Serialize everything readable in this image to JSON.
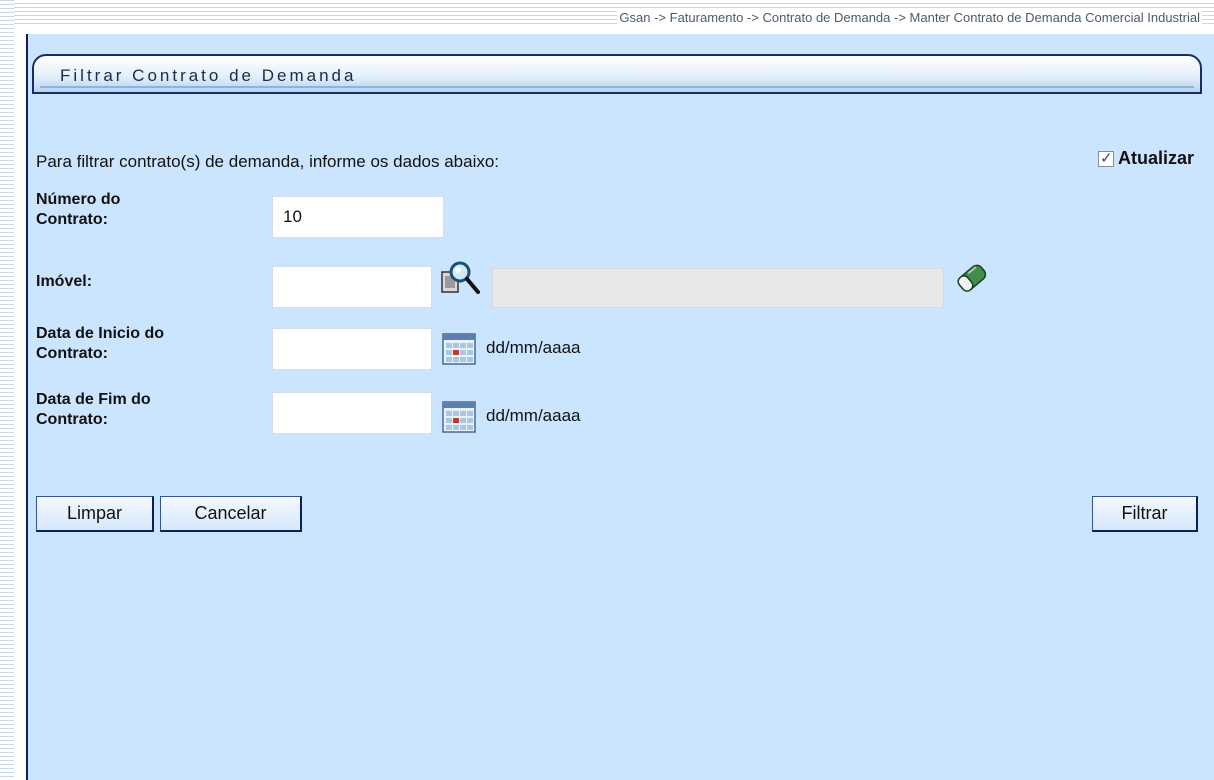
{
  "breadcrumb": "Gsan -> Faturamento -> Contrato de Demanda -> Manter Contrato de Demanda Comercial Industrial",
  "panel": {
    "title": "Filtrar Contrato de Demanda",
    "instructions": "Para filtrar contrato(s) de demanda, informe os dados abaixo:",
    "atualizar": {
      "label": "Atualizar",
      "checked": true
    }
  },
  "form": {
    "numero_contrato": {
      "label_line1": "Número do",
      "label_line2": "Contrato:",
      "value": "10"
    },
    "imovel": {
      "label": "Imóvel:",
      "value": "",
      "description": ""
    },
    "data_inicio": {
      "label_line1": "Data de Inicio do",
      "label_line2": "Contrato:",
      "value": "",
      "hint": "dd/mm/aaaa"
    },
    "data_fim": {
      "label_line1": "Data de Fim do",
      "label_line2": "Contrato:",
      "value": "",
      "hint": "dd/mm/aaaa"
    }
  },
  "buttons": {
    "limpar": "Limpar",
    "cancelar": "Cancelar",
    "filtrar": "Filtrar"
  },
  "icons": {
    "search": "search-icon",
    "eraser": "eraser-icon",
    "calendar": "calendar-icon"
  },
  "colors": {
    "panel_bg": "#cce5ff",
    "border_dark": "#0b1f5c"
  }
}
